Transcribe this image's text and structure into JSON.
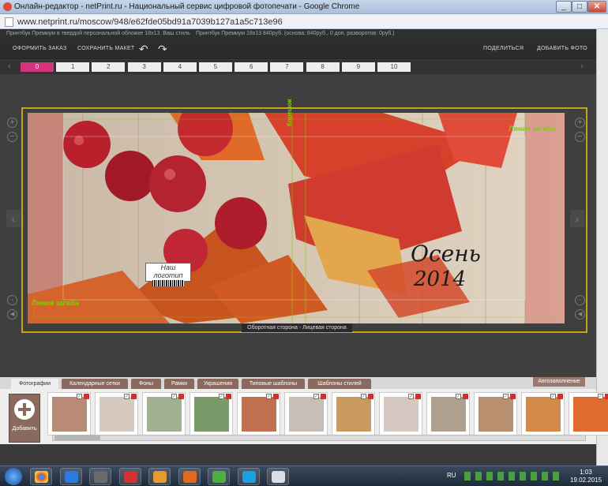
{
  "window": {
    "title": "Онлайн-редактор - netPrint.ru - Национальный сервис цифровой фотопечати - Google Chrome",
    "min": "_",
    "max": "□",
    "close": "✕"
  },
  "address": {
    "url": "www.netprint.ru/moscow/948/e62fde05bd91a7039b127a1a5c713e96"
  },
  "info": {
    "left": "Принтбук Премиум в твердой персональной обложке 18х13. Ваш стиль",
    "right": "Принтбук Премиум 18х13 840руб. (основа: 840руб., 0 доп. разворотов: 0руб.)"
  },
  "toolbar": {
    "order": "ОФОРМИТЬ ЗАКАЗ",
    "save": "СОХРАНИТЬ МАКЕТ",
    "undo": "↶",
    "redo": "↷",
    "share": "ПОДЕЛИТЬСЯ",
    "add_photo": "ДОБАВИТЬ ФОТО"
  },
  "pages": [
    "0",
    "1",
    "2",
    "3",
    "4",
    "5",
    "6",
    "7",
    "8",
    "9",
    "10"
  ],
  "canvas": {
    "fold_left": "Линия загиба",
    "fold_right": "Линия загиба",
    "spine": "Корешок",
    "title_line1": "Осень",
    "title_line2": "2014",
    "logo": "Наш логотип",
    "side_label": "Оборотная сторона - Лицевая сторона"
  },
  "bottom_tabs": [
    "Фотографии",
    "Календарные сетки",
    "Фоны",
    "Рамки",
    "Украшения",
    "Типовые шаблоны",
    "Шаблоны стилей"
  ],
  "autofill": "Автозаполнение",
  "add_button": "Добавить",
  "taskbar": {
    "lang": "RU",
    "time": "1:03",
    "date": "19.02.2015"
  },
  "colors": {
    "accent": "#d6337d",
    "frame": "#c8a21a",
    "fold": "#7fd000"
  }
}
